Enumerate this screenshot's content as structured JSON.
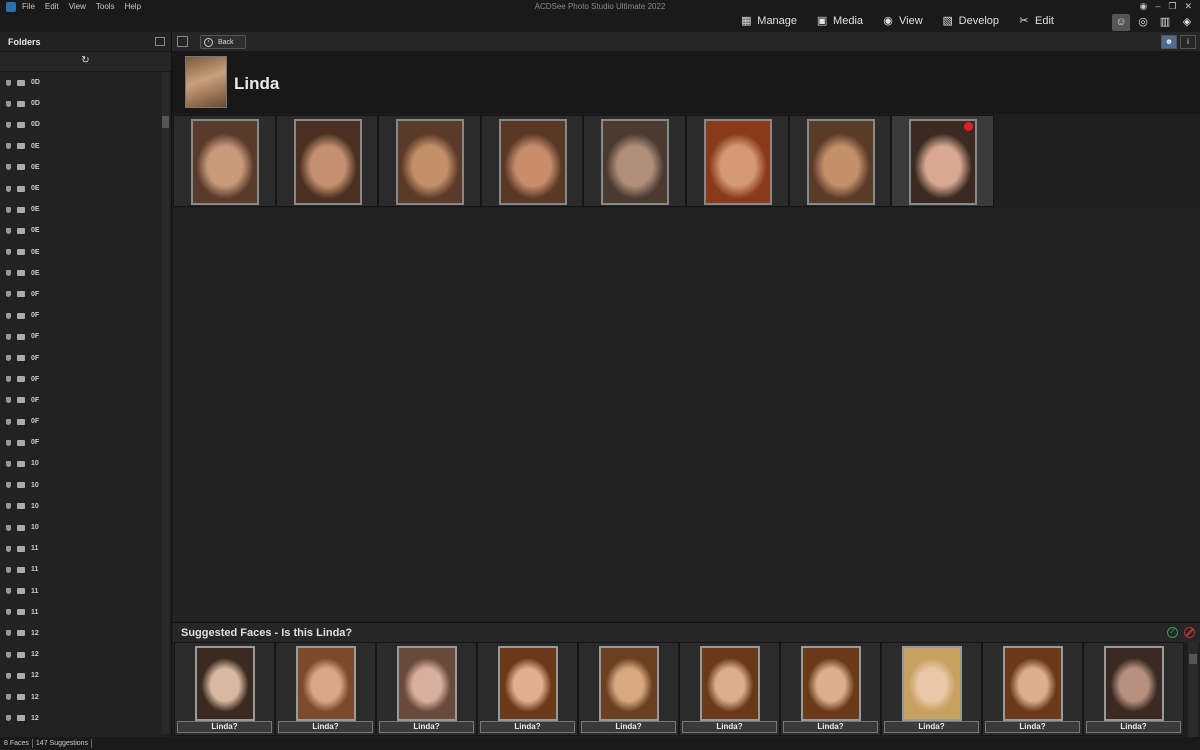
{
  "app": {
    "title": "ACDSee Photo Studio Ultimate 2022",
    "menu": [
      "File",
      "Edit",
      "View",
      "Tools",
      "Help"
    ]
  },
  "modes": [
    {
      "label": "Manage",
      "icon": "grid-icon"
    },
    {
      "label": "Media",
      "icon": "media-icon"
    },
    {
      "label": "View",
      "icon": "eye-icon"
    },
    {
      "label": "Develop",
      "icon": "develop-icon"
    },
    {
      "label": "Edit",
      "icon": "edit-icon"
    }
  ],
  "leftpanel": {
    "title": "Folders",
    "folders": [
      "0D",
      "0D",
      "0D",
      "0E",
      "0E",
      "0E",
      "0E",
      "0E",
      "0E",
      "0E",
      "0F",
      "0F",
      "0F",
      "0F",
      "0F",
      "0F",
      "0F",
      "0F",
      "10",
      "10",
      "10",
      "10",
      "11",
      "11",
      "11",
      "11",
      "12",
      "12",
      "12",
      "12",
      "12"
    ]
  },
  "navbar": {
    "back_label": "Back"
  },
  "person": {
    "name": "Linda"
  },
  "faces": {
    "count": 8,
    "tones": [
      [
        "#5a3a2a",
        "#c89a7a",
        "#3a2418"
      ],
      [
        "#4a3020",
        "#c59070",
        "#2a1a10"
      ],
      [
        "#5a3a28",
        "#c4906a",
        "#3a2214"
      ],
      [
        "#5a3826",
        "#c88e6c",
        "#3a2214"
      ],
      [
        "#4a3a30",
        "#b0907a",
        "#2a2420"
      ],
      [
        "#8a3a18",
        "#d49a78",
        "#4a2a18"
      ],
      [
        "#5a3a28",
        "#c4906a",
        "#3a2214"
      ],
      [
        "#3a2a22",
        "#d8a890",
        "#6a3a24"
      ]
    ]
  },
  "suggested": {
    "title": "Suggested Faces - Is this Linda?",
    "label": "Linda?",
    "tones": [
      [
        "#3a2a20",
        "#d8b8a0",
        "#1a1410"
      ],
      [
        "#7a4a2a",
        "#d8a888",
        "#3a2010"
      ],
      [
        "#6a4a3a",
        "#d8b0a0",
        "#4a3028"
      ],
      [
        "#6a3a18",
        "#e0b090",
        "#4a2810"
      ],
      [
        "#6a4020",
        "#d8a880",
        "#3a2410"
      ],
      [
        "#6a3a18",
        "#dcae8c",
        "#4a2810"
      ],
      [
        "#6a3a18",
        "#dcae8c",
        "#4a2810"
      ],
      [
        "#c8a060",
        "#e8c8a8",
        "#8a6a40"
      ],
      [
        "#6a3a18",
        "#dcae8c",
        "#4a2810"
      ],
      [
        "#3a2a22",
        "#b89080",
        "#2a1a14"
      ]
    ]
  },
  "status": {
    "faces": "8 Faces",
    "suggestions": "147 Suggestions"
  }
}
